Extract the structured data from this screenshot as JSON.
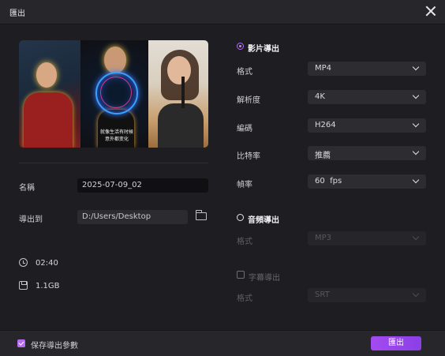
{
  "window": {
    "title": "匯出"
  },
  "left": {
    "name_label": "名稱",
    "name_value": "2025-07-09_02",
    "export_to_label": "導出到",
    "export_to_value": "D:/Users/Desktop",
    "duration": "02:40",
    "size": "1.1GB",
    "preview_lyric": "就像生活有时候\n意外都变化"
  },
  "right": {
    "video_export": {
      "label": "影片導出",
      "selected": true,
      "rows": [
        {
          "label": "格式",
          "value": "MP4"
        },
        {
          "label": "解析度",
          "value": "4K"
        },
        {
          "label": "編碼",
          "value": "H264"
        },
        {
          "label": "比特率",
          "value": "推薦"
        },
        {
          "label": "幀率",
          "value": "60  fps"
        }
      ]
    },
    "audio_export": {
      "label": "音頻導出",
      "selected": false,
      "format_label": "格式",
      "format_value": "MP3"
    },
    "subtitle_export": {
      "label": "字幕導出",
      "checked": false,
      "format_label": "格式",
      "format_value": "SRT"
    }
  },
  "footer": {
    "save_params_label": "保存導出參數",
    "save_params_checked": true,
    "export_button": "匯出"
  },
  "colors": {
    "accent": "#a34bf0",
    "background": "#1e1e22"
  },
  "icons": [
    "close-icon",
    "folder-icon",
    "clock-icon",
    "file-size-icon",
    "radio-selected-icon",
    "radio-icon",
    "checkbox-icon",
    "chevron-down-icon"
  ]
}
